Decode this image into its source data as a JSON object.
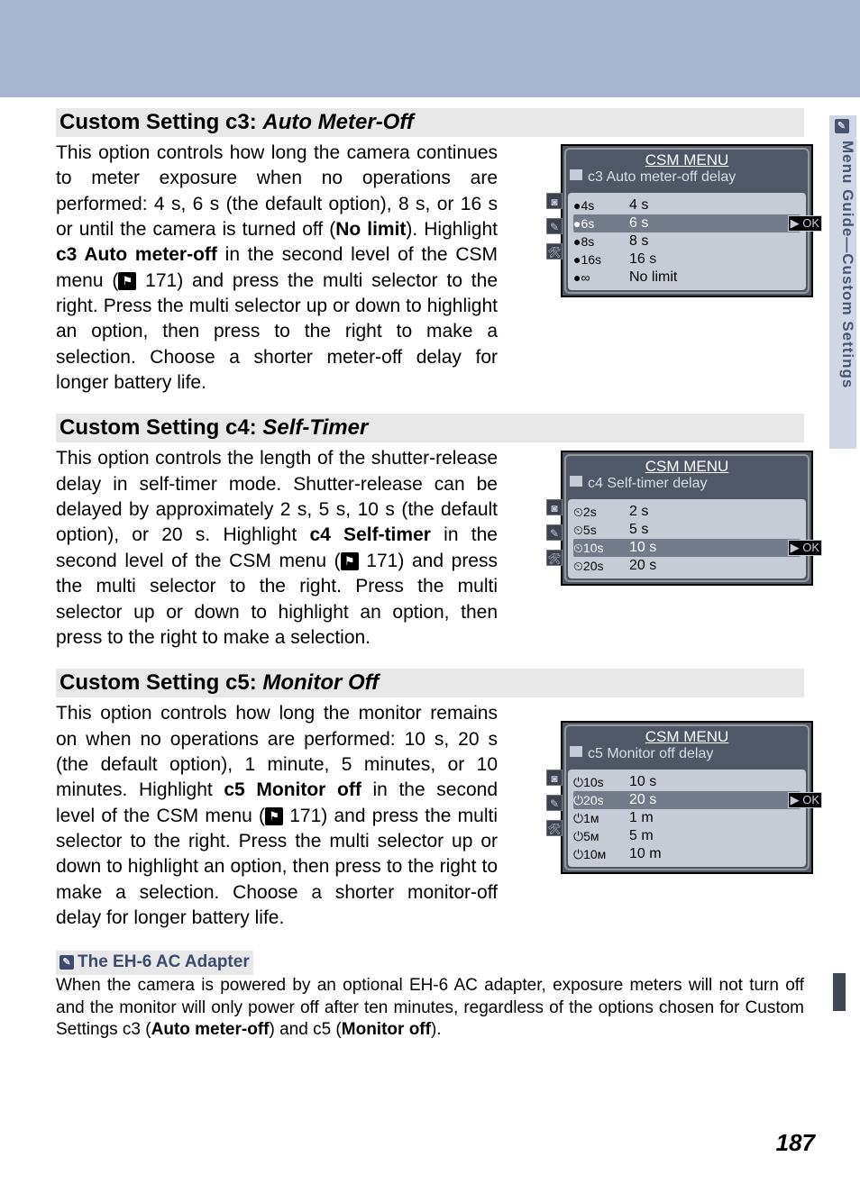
{
  "side_tab": "Menu Guide—Custom Settings",
  "page_number": "187",
  "sections": {
    "c3": {
      "heading_prefix": "Custom Setting c3: ",
      "heading_italic": "Auto Meter-Off",
      "body_parts": {
        "p1": "This option controls how long the camera continues to meter exposure when no operations are performed: 4 s, 6 s (the default option), 8 s, or 16 s or until the camera is turned off (",
        "b1": "No limit",
        "p2": ").  Highlight ",
        "b2": "c3 Auto meter-off",
        "p3": " in the second level of the CSM menu (",
        "ref": "171",
        "p4": ") and press the multi selector to the right.  Press the multi selector up or down to highlight an option, then press to the right to make a selection.  Choose a shorter meter-off delay for longer battery life."
      }
    },
    "c4": {
      "heading_prefix": "Custom Setting c4: ",
      "heading_italic": "Self-Timer",
      "body_parts": {
        "p1": "This option controls the length of the shutter-release delay in self-timer mode.  Shutter-release can be delayed by approximately 2 s, 5 s, 10 s (the default option), or 20 s.  Highlight ",
        "b1": "c4 Self-timer",
        "p2": " in the second level of the CSM menu (",
        "ref": "171",
        "p3": ") and press the multi selector to the right.  Press the multi selector up or down to highlight an option, then press to the right to make a selection."
      }
    },
    "c5": {
      "heading_prefix": "Custom Setting c5: ",
      "heading_italic": "Monitor Off",
      "body_parts": {
        "p1": "This option controls how long the monitor remains on when no operations are performed: 10 s, 20 s (the default option), 1 minute, 5 minutes, or 10 minutes.  Highlight ",
        "b1": "c5 Monitor off",
        "p2": " in the second level of the CSM menu (",
        "ref": "171",
        "p3": ") and press the multi selector to the right.  Press the multi selector up or down to highlight an option, then press to the right to make a selection.  Choose a shorter monitor-off delay for longer battery life."
      }
    }
  },
  "csm_menus": {
    "c3": {
      "title": "CSM MENU",
      "subtitle": "c3  Auto meter-off delay",
      "selected_index": 1,
      "rows": [
        {
          "icon": "●4s",
          "label": "4 s"
        },
        {
          "icon": "●6s",
          "label": "6 s"
        },
        {
          "icon": "●8s",
          "label": "8 s"
        },
        {
          "icon": "●16s",
          "label": "16 s"
        },
        {
          "icon": "●∞",
          "label": "No limit"
        }
      ]
    },
    "c4": {
      "title": "CSM MENU",
      "subtitle": "c4  Self-timer delay",
      "selected_index": 2,
      "rows": [
        {
          "icon": "⏲2s",
          "label": "2 s"
        },
        {
          "icon": "⏲5s",
          "label": "5 s"
        },
        {
          "icon": "⏲10s",
          "label": "10 s"
        },
        {
          "icon": "⏲20s",
          "label": "20 s"
        }
      ]
    },
    "c5": {
      "title": "CSM MENU",
      "subtitle": "c5  Monitor off delay",
      "selected_index": 1,
      "rows": [
        {
          "icon": "⏻10s",
          "label": "10 s"
        },
        {
          "icon": "⏻20s",
          "label": "20 s"
        },
        {
          "icon": "⏻1ᴍ",
          "label": "1 m"
        },
        {
          "icon": "⏻5ᴍ",
          "label": "5 m"
        },
        {
          "icon": "⏻10ᴍ",
          "label": "10 m"
        }
      ]
    }
  },
  "ok_label": "OK",
  "note": {
    "title": "The EH-6 AC Adapter",
    "body_parts": {
      "p1": "When the camera is powered by an optional EH-6 AC adapter, exposure meters will not turn off and the monitor will only power off after ten minutes, regardless of the options chosen for Custom Settings c3 (",
      "b1": "Auto meter-off",
      "p2": ") and c5 (",
      "b2": "Monitor off",
      "p3": ")."
    }
  }
}
